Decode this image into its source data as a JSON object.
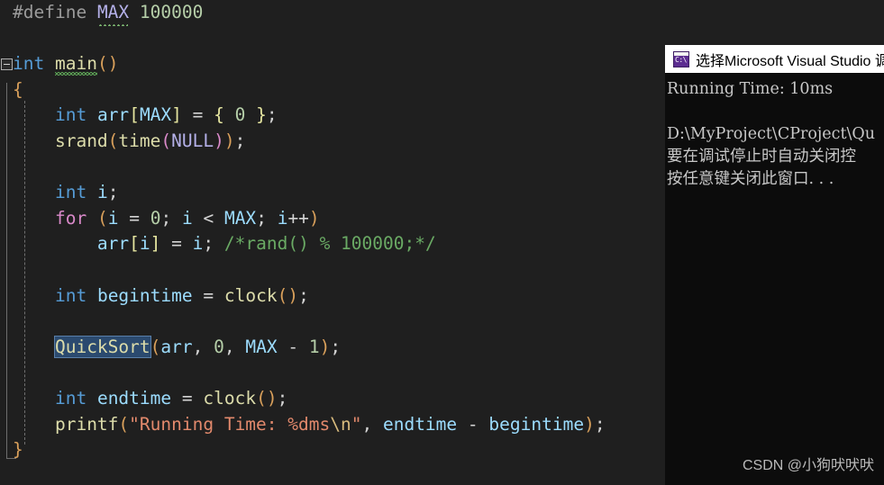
{
  "editor": {
    "background_color": "#1f1f1f",
    "font_size_px": 19.5,
    "code_lines": [
      {
        "id": "line-define",
        "text": "#define MAX 100000"
      },
      {
        "id": "line-blank-1",
        "text": ""
      },
      {
        "id": "line-main",
        "text": "int main()"
      },
      {
        "id": "line-open",
        "text": "{"
      },
      {
        "id": "line-arr",
        "text": "    int arr[MAX] = { 0 };"
      },
      {
        "id": "line-srand",
        "text": "    srand(time(NULL));"
      },
      {
        "id": "line-blank-2",
        "text": ""
      },
      {
        "id": "line-decl-i",
        "text": "    int i;"
      },
      {
        "id": "line-for",
        "text": "    for (i = 0; i < MAX; i++)"
      },
      {
        "id": "line-assign",
        "text": "        arr[i] = i; /*rand() % 100000;*/"
      },
      {
        "id": "line-blank-3",
        "text": ""
      },
      {
        "id": "line-begintime",
        "text": "    int begintime = clock();"
      },
      {
        "id": "line-blank-4",
        "text": ""
      },
      {
        "id": "line-quicksort",
        "text": "    QuickSort(arr, 0, MAX - 1);"
      },
      {
        "id": "line-blank-5",
        "text": ""
      },
      {
        "id": "line-endtime",
        "text": "    int endtime = clock();"
      },
      {
        "id": "line-printf",
        "text": "    printf(\"Running Time: %dms\\n\", endtime - begintime);"
      },
      {
        "id": "line-close",
        "text": "}"
      }
    ],
    "tokens": {
      "define_directive": "#define",
      "define_name": "MAX",
      "define_value": "100000",
      "kw_int": "int",
      "kw_for": "for",
      "fn_main": "main",
      "fn_srand": "srand",
      "fn_time": "time",
      "fn_clock": "clock",
      "fn_printf": "printf",
      "fn_quicksort": "QuickSort",
      "const_null": "NULL",
      "macro_max": "MAX",
      "var_arr": "arr",
      "var_i": "i",
      "var_begintime": "begintime",
      "var_endtime": "endtime",
      "num_zero": "0",
      "num_one": "1",
      "string_literal": "\"Running Time: %dms\\n\"",
      "string_body": "\"Running Time: %dms",
      "string_escape": "\\n",
      "string_tail": "\"",
      "comment": "/*rand() % 100000;*/",
      "brace_open": "{",
      "brace_close": "}",
      "semicolon": ";"
    },
    "selection": {
      "selected_text": "QuickSort",
      "highlight_color": "#2b4a6f",
      "border_color": "#5a7fa8"
    },
    "colors": {
      "keyword": "#569cd6",
      "control_keyword": "#d989c9",
      "function": "#dcdcaa",
      "variable": "#9cdcfe",
      "macro": "#b4b0e8",
      "number": "#b5cea8",
      "string": "#e2896c",
      "escape": "#d7ba7d",
      "comment": "#6aaa64",
      "preprocessor": "#9b9b9b",
      "punctuation": "#d4d4d4"
    },
    "gutter": {
      "fold_marker": "collapse-box",
      "fold_marker_state": "expanded"
    }
  },
  "console": {
    "title": "选择Microsoft Visual Studio 调",
    "icon_name": "cmd-icon",
    "icon_label": "C:\\",
    "titlebar_color": "#ffffff",
    "background_color": "#0c0c0c",
    "text_color": "#c8c8c8",
    "lines": [
      "Running Time: 10ms",
      "",
      "D:\\MyProject\\CProject\\Qu",
      "要在调试停止时自动关闭控",
      "按任意键关闭此窗口. . ."
    ]
  },
  "watermark": {
    "text": "CSDN @小狗吠吠吠"
  }
}
